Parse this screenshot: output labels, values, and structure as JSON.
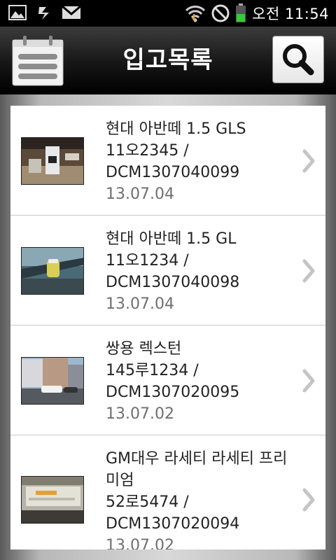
{
  "status_bar": {
    "time": "오전 11:54",
    "icons": [
      "gallery-icon",
      "usb-icon",
      "gmail-icon",
      "wifi-icon",
      "no-sound-icon",
      "battery-icon"
    ]
  },
  "header": {
    "title": "입고목록",
    "left_icon": "notepad-icon",
    "right_icon": "search-icon"
  },
  "items": [
    {
      "model": "현대 아반떼 1.5 GLS",
      "plate": "11오2345 /",
      "code": "DCM1307040099",
      "date": "13.07.04"
    },
    {
      "model": "현대 아반떼 1.5 GL",
      "plate": "11오1234 /",
      "code": "DCM1307040098",
      "date": "13.07.04"
    },
    {
      "model": "쌍용 렉스턴",
      "plate": "145루1234 /",
      "code": "DCM1307020095",
      "date": "13.07.02"
    },
    {
      "model": "GM대우 라세티 라세티 프리미엄",
      "plate": "52로5474 /",
      "code": "DCM1307020094",
      "date": "13.07.02"
    }
  ]
}
